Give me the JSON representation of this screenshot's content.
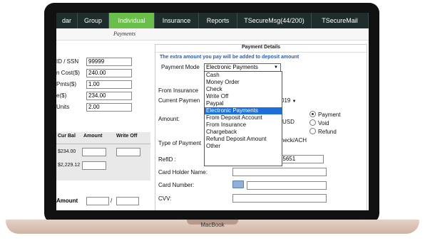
{
  "nav": {
    "items": [
      "dar",
      "Group",
      "Individual",
      "Insurance",
      "Reports",
      "TSecureMsg(44/200)",
      "TSecureMail"
    ],
    "active": "Individual"
  },
  "subbar": {
    "title": "Payments"
  },
  "left": {
    "fields": [
      {
        "label": "ID / SSN",
        "value": "99999"
      },
      {
        "label": "n Cost($)",
        "value": "240.00"
      },
      {
        "label": "Pmts($)",
        "value": "1.00"
      },
      {
        "label": "e($)",
        "value": "234.00"
      },
      {
        "label": "Units",
        "value": "2.00"
      }
    ],
    "grid": {
      "headers": [
        "Cur Bal",
        "Amount",
        "Write Off"
      ],
      "rows": [
        "$234.00",
        "$2,229.12"
      ]
    },
    "amount_label": "Amount",
    "amount_sep": "/"
  },
  "panel": {
    "title": "Payment Details",
    "note": "The extra amount you pay will be added to deposit amount",
    "payment_mode_label": "Payment Mode",
    "payment_mode_value": "Electronic Payments",
    "options": [
      "Cash",
      "Money Order",
      "Check",
      "Write Off",
      "Paypal",
      "Electronic Payments",
      "From Deposit Account",
      "From Insurance",
      "Chargeback",
      "Refund Deposit Amount",
      "Other"
    ],
    "selected_option": "Electronic Payments",
    "from_insurance_label": "From Insurance",
    "current_payment_label": "Current Paymen",
    "current_payment_tail": "019",
    "amount_label": "Amount:",
    "amount_currency": "USD",
    "radios": [
      "Payment",
      "Void",
      "Refund"
    ],
    "radio_selected": "Payment",
    "type_of_payment_label": "Type of Payment",
    "type_of_payment_tail": "heck/ACH",
    "refid_label": "RefID :",
    "refid_value": "201962515448-7865651",
    "card_holder_label": "Card Holder Name:",
    "card_number_label": "Card Number:",
    "cvv_label": "CVV:",
    "colors": {
      "nav_bg": "#1f2d2d",
      "active_tab": "#6abf4b",
      "highlight": "#1e6fd9",
      "note": "#2a5db0"
    }
  },
  "device": {
    "label": "MacBook"
  }
}
